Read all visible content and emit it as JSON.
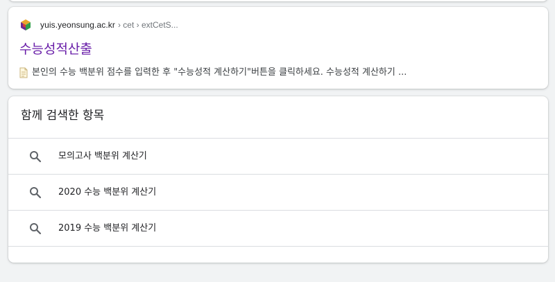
{
  "result": {
    "site_url": "yuis.yeonsung.ac.kr",
    "breadcrumb": "› cet › extCetS...",
    "title": "수능성적산출",
    "snippet": "본인의 수능 백분위 점수를 입력한 후 \"수능성적 계산하기\"버튼을 클릭하세요. 수능성적 계산하기 ..."
  },
  "related": {
    "header": "함께 검색한 항목",
    "items": [
      {
        "label": "모의고사 백분위 계산기",
        "icon": "search-icon"
      },
      {
        "label": "2020 수능 백분위 계산기",
        "icon": "search-icon"
      },
      {
        "label": "2019 수능 백분위 계산기",
        "icon": "search-icon"
      }
    ]
  },
  "colors": {
    "title_visited": "#681da8",
    "text": "#202124",
    "secondary": "#70757a",
    "divider": "#dadce0",
    "background": "#f1f3f4"
  }
}
